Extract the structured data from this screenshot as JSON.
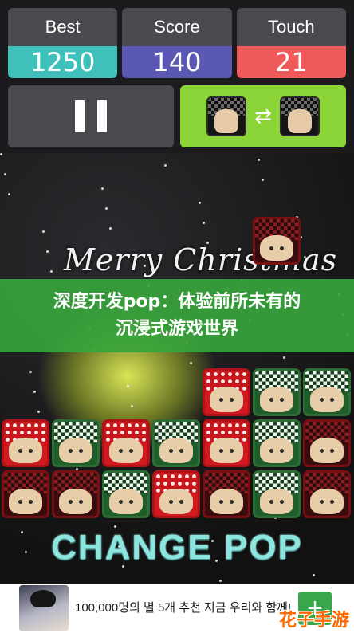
{
  "hud": {
    "best": {
      "label": "Best",
      "value": "1250",
      "color": "#40c0bb"
    },
    "score": {
      "label": "Score",
      "value": "140",
      "color": "#5a58b3"
    },
    "touch": {
      "label": "Touch",
      "value": "21",
      "color": "#f05a5a"
    }
  },
  "controls": {
    "pause_icon": "pause-icon",
    "swap_icon": "swap-arrows-icon",
    "swap_arrows": "⇄"
  },
  "board": {
    "background_text": "Merry Christmas",
    "falling_tile": {
      "col": 5,
      "row": 0,
      "style": "dark"
    },
    "rows": [
      [
        "",
        "",
        "",
        "",
        "red",
        "green",
        "green"
      ],
      [
        "red",
        "green",
        "red",
        "green",
        "red",
        "green",
        "dark"
      ],
      [
        "dark",
        "dark",
        "green",
        "red",
        "dark",
        "green",
        "dark"
      ]
    ]
  },
  "game_title": "CHANGE POP",
  "banner": {
    "line1": "深度开发pop：体验前所未有的",
    "line2": "沉浸式游戏世界"
  },
  "ad": {
    "text": "100,000명의 별 5개 추천 지금 우리와 함께!",
    "button": "+"
  },
  "watermark": "花子手游"
}
